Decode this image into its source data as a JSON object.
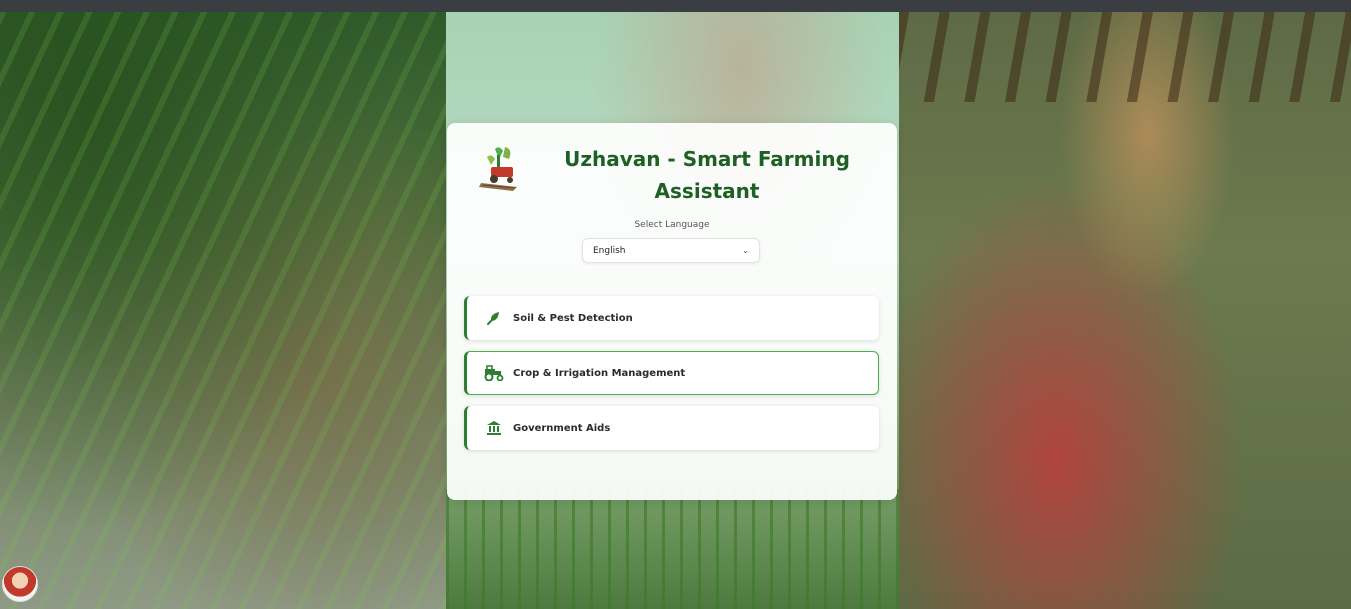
{
  "app": {
    "title": "Uzhavan - Smart Farming Assistant"
  },
  "language": {
    "label": "Select Language",
    "selected": "English"
  },
  "options": [
    {
      "label": "Soil & Pest Detection",
      "icon": "leaf-pen-icon"
    },
    {
      "label": "Crop & Irrigation Management",
      "icon": "tractor-icon"
    },
    {
      "label": "Government Aids",
      "icon": "government-building-icon"
    }
  ],
  "colors": {
    "brand_green": "#1e5f24",
    "accent_green": "#2e7d32",
    "active_border": "#4caf50"
  }
}
